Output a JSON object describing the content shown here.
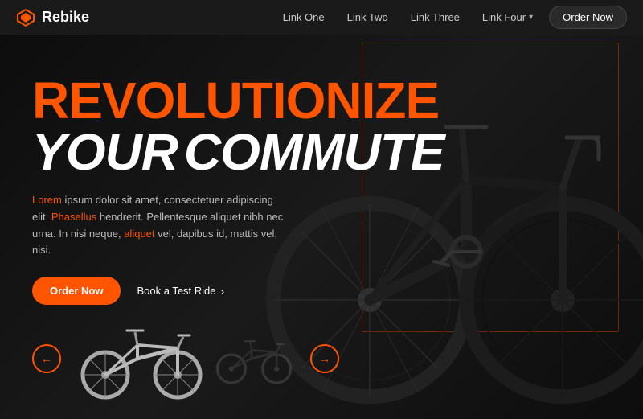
{
  "brand": {
    "name": "Rebike",
    "logo_symbol": "◆"
  },
  "nav": {
    "links": [
      {
        "label": "Link One",
        "has_dropdown": false
      },
      {
        "label": "Link Two",
        "has_dropdown": false
      },
      {
        "label": "Link Three",
        "has_dropdown": false
      },
      {
        "label": "Link Four",
        "has_dropdown": true
      }
    ],
    "order_button": "Order Now"
  },
  "hero": {
    "title_line1": "REVOLUTIONIZE",
    "title_line2_your": "YOUR",
    "title_line2_commute": "COMMUTE",
    "description": {
      "prefix": "Lorem",
      "middle1": " ipsum dolor sit amet, consectetuer adipiscing elit. ",
      "highlight1": "Phasellus",
      "middle2": " hendrerit. Pellentesque aliquet nibh nec urna. In nisi neque, ",
      "highlight2": "aliquet",
      "suffix": " vel, dapibus id, mattis vel, nisi."
    },
    "order_button": "Order Now",
    "test_ride_button": "Book a Test Ride"
  },
  "carousel": {
    "prev_label": "←",
    "next_label": "→"
  },
  "colors": {
    "orange": "#ff5500",
    "dark_bg": "#111111",
    "nav_bg": "#1a1a1a"
  }
}
